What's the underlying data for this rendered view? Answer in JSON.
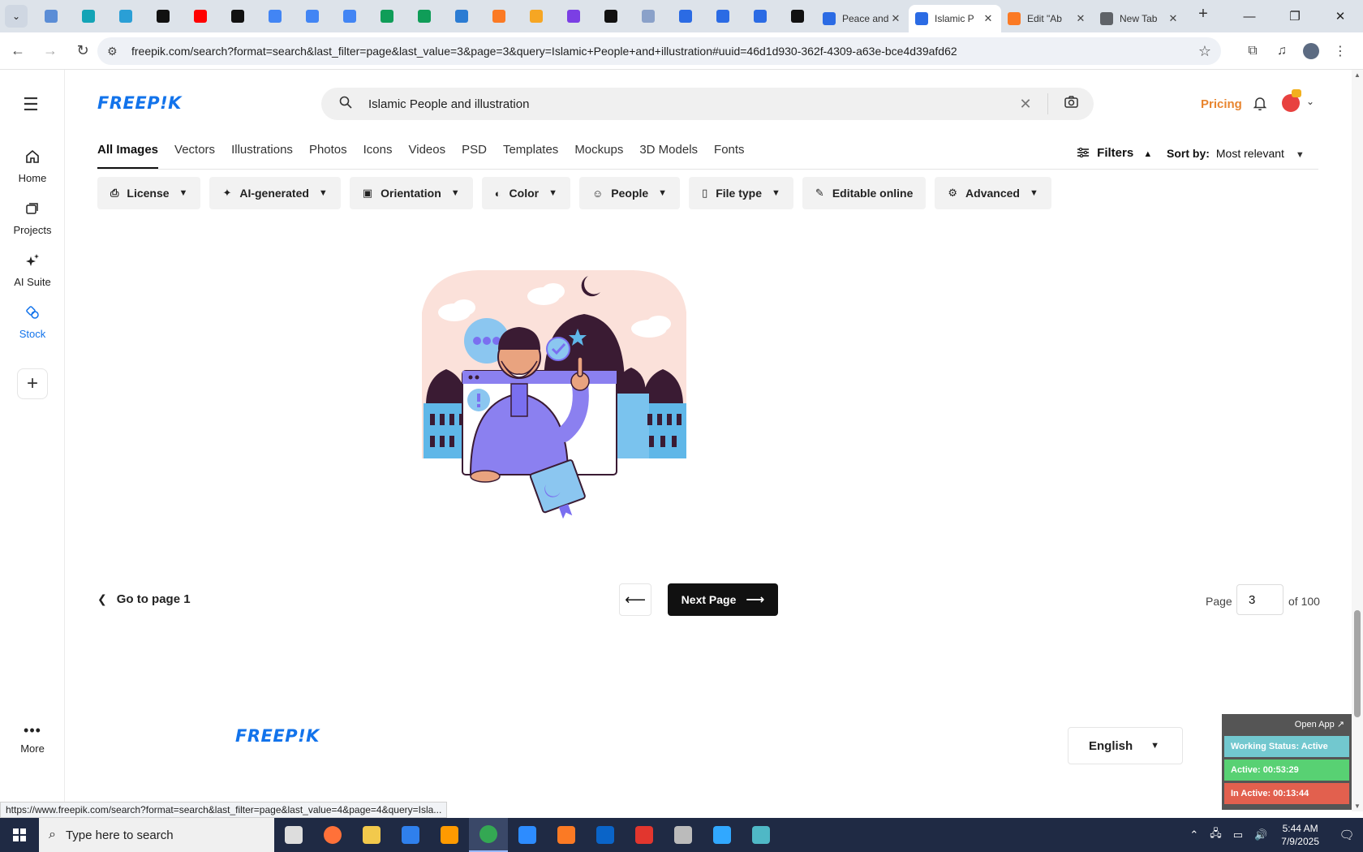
{
  "browser": {
    "pinned_tabs": [
      {
        "icon": "globe-icon",
        "color": "#5b8dd6"
      },
      {
        "icon": "vpn-icon",
        "color": "#13a4b6"
      },
      {
        "icon": "hex-icon",
        "color": "#2a9fd6"
      },
      {
        "icon": "openai-icon",
        "color": "#111111"
      },
      {
        "icon": "youtube-icon",
        "color": "#ff0000"
      },
      {
        "icon": "bolt-icon",
        "color": "#111111"
      },
      {
        "icon": "docs-icon",
        "color": "#4285f4"
      },
      {
        "icon": "docs-icon",
        "color": "#4285f4"
      },
      {
        "icon": "docs-icon",
        "color": "#4285f4"
      },
      {
        "icon": "sheets-icon",
        "color": "#0f9d58"
      },
      {
        "icon": "sheets-icon",
        "color": "#0f9d58"
      },
      {
        "icon": "word-icon",
        "color": "#2b7cd3"
      },
      {
        "icon": "xampp-icon",
        "color": "#fb7a24"
      },
      {
        "icon": "vee-icon",
        "color": "#f6a623"
      },
      {
        "icon": "braces-icon",
        "color": "#7b3fe4"
      },
      {
        "icon": "bolt-icon",
        "color": "#111111"
      },
      {
        "icon": "grid-icon",
        "color": "#8aa1c9"
      },
      {
        "icon": "forms-icon",
        "color": "#2b6be4"
      },
      {
        "icon": "forms-icon",
        "color": "#2b6be4"
      },
      {
        "icon": "forms-icon",
        "color": "#2b6be4"
      },
      {
        "icon": "medium-icon",
        "color": "#111111"
      }
    ],
    "tabs": [
      {
        "title": "Peace and",
        "color": "#2b6be4",
        "active": false
      },
      {
        "title": "Islamic P",
        "color": "#2b6be4",
        "active": true
      },
      {
        "title": "Edit \"Ab",
        "color": "#fb7a24",
        "active": false
      },
      {
        "title": "New Tab",
        "color": "#5f6368",
        "active": false
      }
    ],
    "url": "freepik.com/search?format=search&last_filter=page&last_value=3&page=3&query=Islamic+People+and+illustration#uuid=46d1d930-362f-4309-a63e-bce4d39afd62"
  },
  "rail": {
    "items": [
      {
        "label": "Home",
        "icon": "home-icon"
      },
      {
        "label": "Projects",
        "icon": "projects-icon"
      },
      {
        "label": "AI Suite",
        "icon": "sparkle-icon"
      },
      {
        "label": "Stock",
        "icon": "stock-icon"
      }
    ],
    "more_label": "More"
  },
  "header": {
    "logo": "FREEP!K",
    "search_value": "Islamic People and illustration",
    "pricing_label": "Pricing"
  },
  "type_tabs": [
    "All Images",
    "Vectors",
    "Illustrations",
    "Photos",
    "Icons",
    "Videos",
    "PSD",
    "Templates",
    "Mockups",
    "3D Models",
    "Fonts"
  ],
  "filters_label": "Filters",
  "sort": {
    "label": "Sort by:",
    "value": "Most relevant"
  },
  "chips": [
    {
      "label": "License",
      "icon": "license-icon"
    },
    {
      "label": "AI-generated",
      "icon": "ai-icon"
    },
    {
      "label": "Orientation",
      "icon": "orientation-icon"
    },
    {
      "label": "Color",
      "icon": "palette-icon"
    },
    {
      "label": "People",
      "icon": "people-icon"
    },
    {
      "label": "File type",
      "icon": "file-icon"
    },
    {
      "label": "Editable online",
      "icon": "pencil-icon"
    },
    {
      "label": "Advanced",
      "icon": "gear-icon"
    }
  ],
  "pagination": {
    "goto_label": "Go to page 1",
    "next_label": "Next Page",
    "page_label": "Page",
    "current_page": "3",
    "of_label": "of 100"
  },
  "footer": {
    "logo": "FREEP!K",
    "language": "English"
  },
  "tracker": {
    "open_app": "Open App ↗",
    "status": "Working Status: Active",
    "active": "Active: 00:53:29",
    "inactive": "In Active: 00:13:44"
  },
  "status_link": "https://www.freepik.com/search?format=search&last_filter=page&last_value=4&page=4&query=Isla...",
  "taskbar": {
    "search_placeholder": "Type here to search",
    "apps": [
      {
        "icon": "task-view-icon",
        "color": "#dddddd"
      },
      {
        "icon": "firefox-icon",
        "color": "#ff7139"
      },
      {
        "icon": "file-explorer-icon",
        "color": "#f2c94c"
      },
      {
        "icon": "vscode-icon",
        "color": "#2f80ed"
      },
      {
        "icon": "illustrator-icon",
        "color": "#ff9a00"
      },
      {
        "icon": "chrome-icon",
        "color": "#34a853"
      },
      {
        "icon": "zoom-icon",
        "color": "#2d8cff"
      },
      {
        "icon": "xampp-icon",
        "color": "#fb7a24"
      },
      {
        "icon": "outlook-icon",
        "color": "#0a64c8"
      },
      {
        "icon": "creative-cloud-icon",
        "color": "#e2362e"
      },
      {
        "icon": "pen-icon",
        "color": "#bbbbbb"
      },
      {
        "icon": "photoshop-icon",
        "color": "#31a8ff"
      },
      {
        "icon": "app-icon",
        "color": "#4fb8c6"
      }
    ],
    "time": "5:44 AM",
    "date": "7/9/2025"
  }
}
